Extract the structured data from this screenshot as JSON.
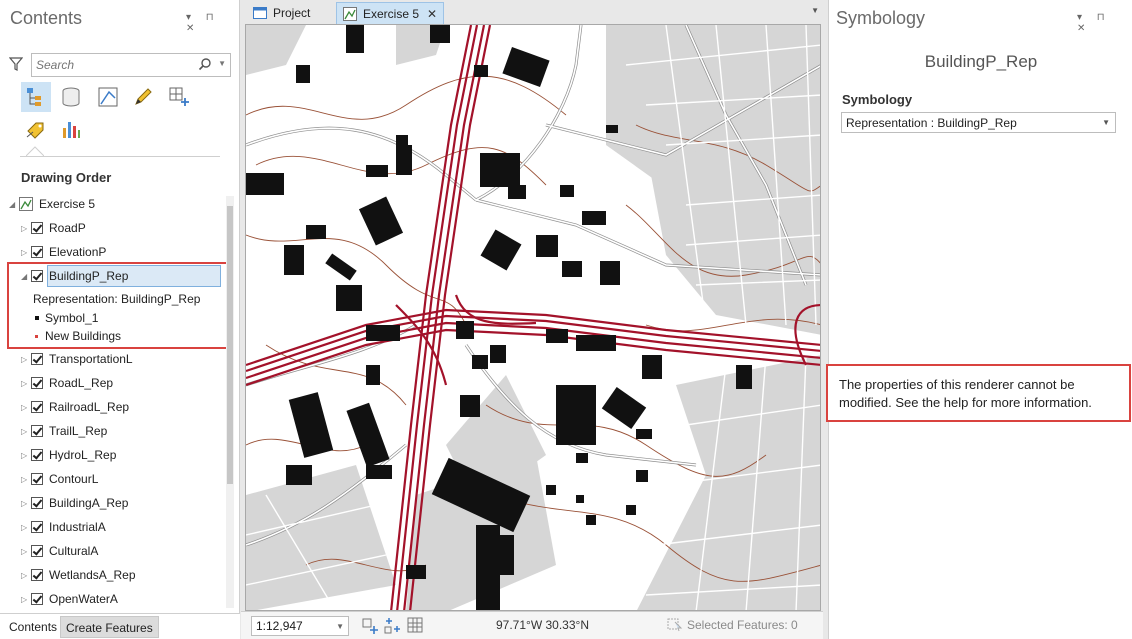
{
  "contents": {
    "title": "Contents",
    "search_placeholder": "Search",
    "drawing_order_label": "Drawing Order",
    "map_name": "Exercise 5",
    "layers_before": [
      "RoadP",
      "ElevationP"
    ],
    "selected_layer": "BuildingP_Rep",
    "representation_label": "Representation: BuildingP_Rep",
    "legend": [
      "Symbol_1",
      "New Buildings"
    ],
    "layers_after": [
      "TransportationL",
      "RoadL_Rep",
      "RailroadL_Rep",
      "TrailL_Rep",
      "HydroL_Rep",
      "ContourL",
      "BuildingA_Rep",
      "IndustrialA",
      "CulturalA",
      "WetlandsA_Rep",
      "OpenWaterA"
    ],
    "bottom_tabs": [
      "Contents",
      "Create Features"
    ]
  },
  "tabs": {
    "project": "Project",
    "exercise": "Exercise 5"
  },
  "status": {
    "scale": "1:12,947",
    "coords": "97.71°W 30.33°N",
    "selected_features": "Selected Features: 0"
  },
  "symbology": {
    "title": "Symbology",
    "layer_name": "BuildingP_Rep",
    "heading": "Symbology",
    "renderer": "Representation : BuildingP_Rep",
    "note": "The properties of this renderer cannot be modified. See the help for more information."
  },
  "colors": {
    "accent_blue": "#cde3f5",
    "highlight_red": "#d9433f",
    "road_red": "#a3122a",
    "contour_brown": "#9a5238",
    "area_gray": "#d6d6d6"
  }
}
